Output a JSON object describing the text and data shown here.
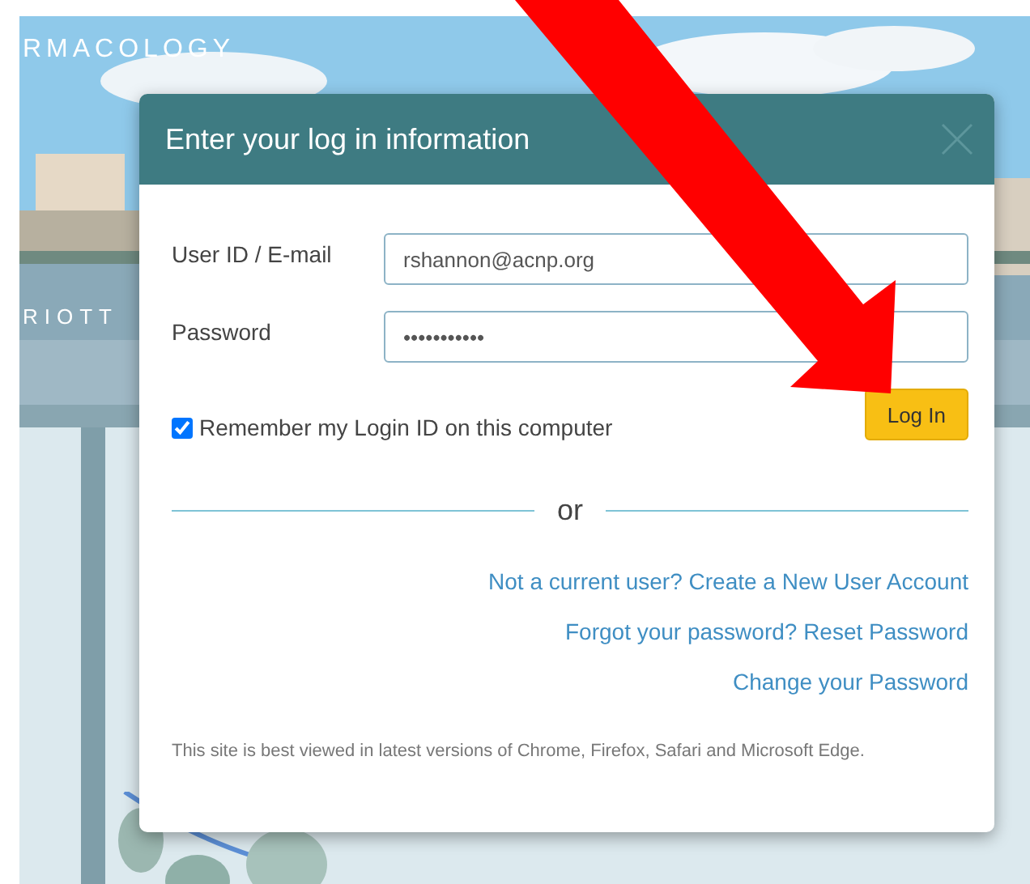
{
  "hero": {
    "heading": "RMACOLOGY",
    "caption": "RIOTT"
  },
  "dialog": {
    "title": "Enter your log in information",
    "fields": [
      {
        "label": "User ID / E-mail",
        "value": "rshannon@acnp.org"
      },
      {
        "label": "Password",
        "value": "•••••••••••"
      }
    ],
    "remember": {
      "label": "Remember my Login ID on this computer",
      "checked": true
    },
    "login_button": "Log In",
    "divider": "or",
    "links": [
      "Not a current user? Create a New User Account",
      "Forgot your password? Reset Password",
      "Change your Password"
    ],
    "note": "This site is best viewed in latest versions of Chrome, Firefox, Safari and Microsoft Edge."
  }
}
